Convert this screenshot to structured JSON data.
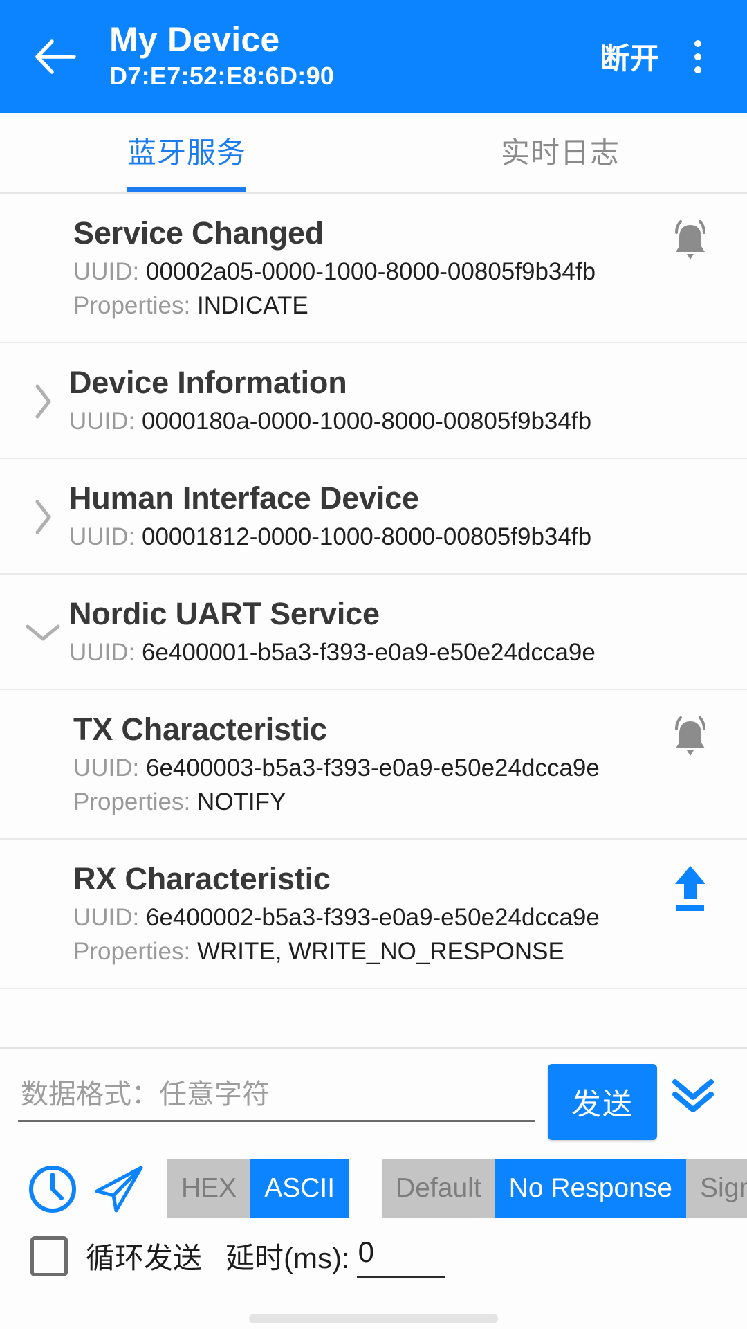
{
  "appbar": {
    "back_icon": "arrow-left-icon",
    "title": "My Device",
    "subtitle": "D7:E7:52:E8:6D:90",
    "action_label": "断开",
    "overflow_icon": "more-vertical-icon",
    "background_color": "#0d84ff"
  },
  "tabs": [
    {
      "label": "蓝牙服务",
      "active": true
    },
    {
      "label": "实时日志",
      "active": false
    }
  ],
  "labels": {
    "uuid_prefix": "UUID: ",
    "properties_prefix": "Properties: "
  },
  "services": [
    {
      "name": "Service Changed",
      "uuid": "00002a05-0000-1000-8000-00805f9b34fb",
      "properties": "INDICATE",
      "chevron": "none",
      "action_icon": "bell-ring-icon",
      "action_icon_color": "#8c8c8c",
      "indented": true
    },
    {
      "name": "Device Information",
      "uuid": "0000180a-0000-1000-8000-00805f9b34fb",
      "properties": "",
      "chevron": "chevron-right-icon",
      "action_icon": "none",
      "action_icon_color": "",
      "indented": false
    },
    {
      "name": "Human Interface Device",
      "uuid": "00001812-0000-1000-8000-00805f9b34fb",
      "properties": "",
      "chevron": "chevron-right-icon",
      "action_icon": "none",
      "action_icon_color": "",
      "indented": false
    },
    {
      "name": "Nordic UART Service",
      "uuid": "6e400001-b5a3-f393-e0a9-e50e24dcca9e",
      "properties": "",
      "chevron": "chevron-down-icon",
      "action_icon": "none",
      "action_icon_color": "",
      "indented": false
    },
    {
      "name": "TX Characteristic",
      "uuid": "6e400003-b5a3-f393-e0a9-e50e24dcca9e",
      "properties": "NOTIFY",
      "chevron": "none",
      "action_icon": "bell-ring-icon",
      "action_icon_color": "#8c8c8c",
      "indented": true
    },
    {
      "name": "RX Characteristic",
      "uuid": "6e400002-b5a3-f393-e0a9-e50e24dcca9e",
      "properties": "WRITE, WRITE_NO_RESPONSE",
      "chevron": "none",
      "action_icon": "upload-icon",
      "action_icon_color": "#0d84ff",
      "indented": true
    }
  ],
  "sendbar": {
    "input_value": "",
    "input_placeholder": "数据格式：任意字符",
    "send_label": "发送",
    "expand_icon": "double-chevron-down-icon",
    "accent_color": "#0d84ff"
  },
  "controls": {
    "history_icon": "clock-icon",
    "quick_send_icon": "paper-plane-icon",
    "format_segment": [
      {
        "label": "HEX",
        "selected": false
      },
      {
        "label": "ASCII",
        "selected": true
      }
    ],
    "write_segment": [
      {
        "label": "Default",
        "selected": false
      },
      {
        "label": "No Response",
        "selected": true
      },
      {
        "label": "Signed",
        "selected": false
      }
    ]
  },
  "loop": {
    "checked": false,
    "loop_label": "循环发送",
    "delay_label": "延时(ms):",
    "delay_value": "0"
  }
}
